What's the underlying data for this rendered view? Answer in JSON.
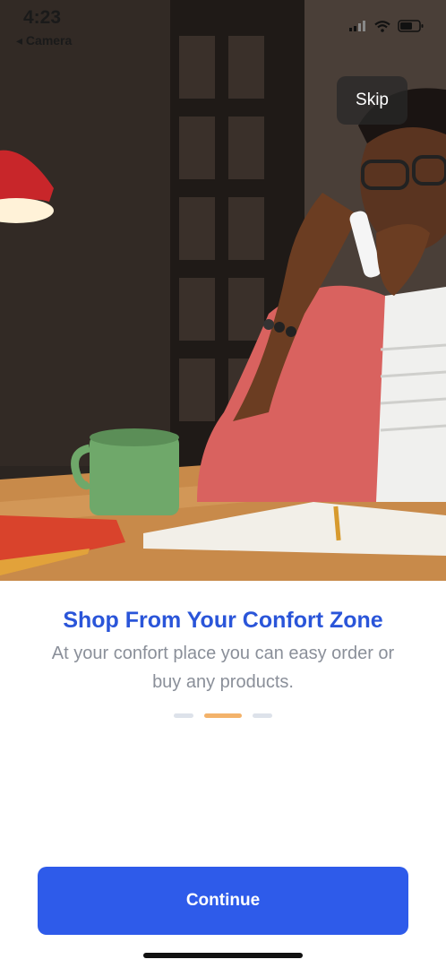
{
  "status_bar": {
    "time": "4:23",
    "back_app": "◂ Camera",
    "signal_icon": "cellular-signal-icon",
    "wifi_icon": "wifi-icon",
    "battery_icon": "battery-icon"
  },
  "hero": {
    "image": "person-on-phone-at-desk-illustration"
  },
  "skip_label": "Skip",
  "onboarding": {
    "title": "Shop From Your Confort Zone",
    "subtitle": "At your confort place you can easy order or buy any products.",
    "page_indicator": {
      "total": 3,
      "active_index": 1
    }
  },
  "continue_label": "Continue",
  "colors": {
    "accent": "#2e5bea",
    "title": "#2a55d9",
    "indicator_active": "#f3b26a",
    "indicator_inactive": "#dde2ea"
  }
}
